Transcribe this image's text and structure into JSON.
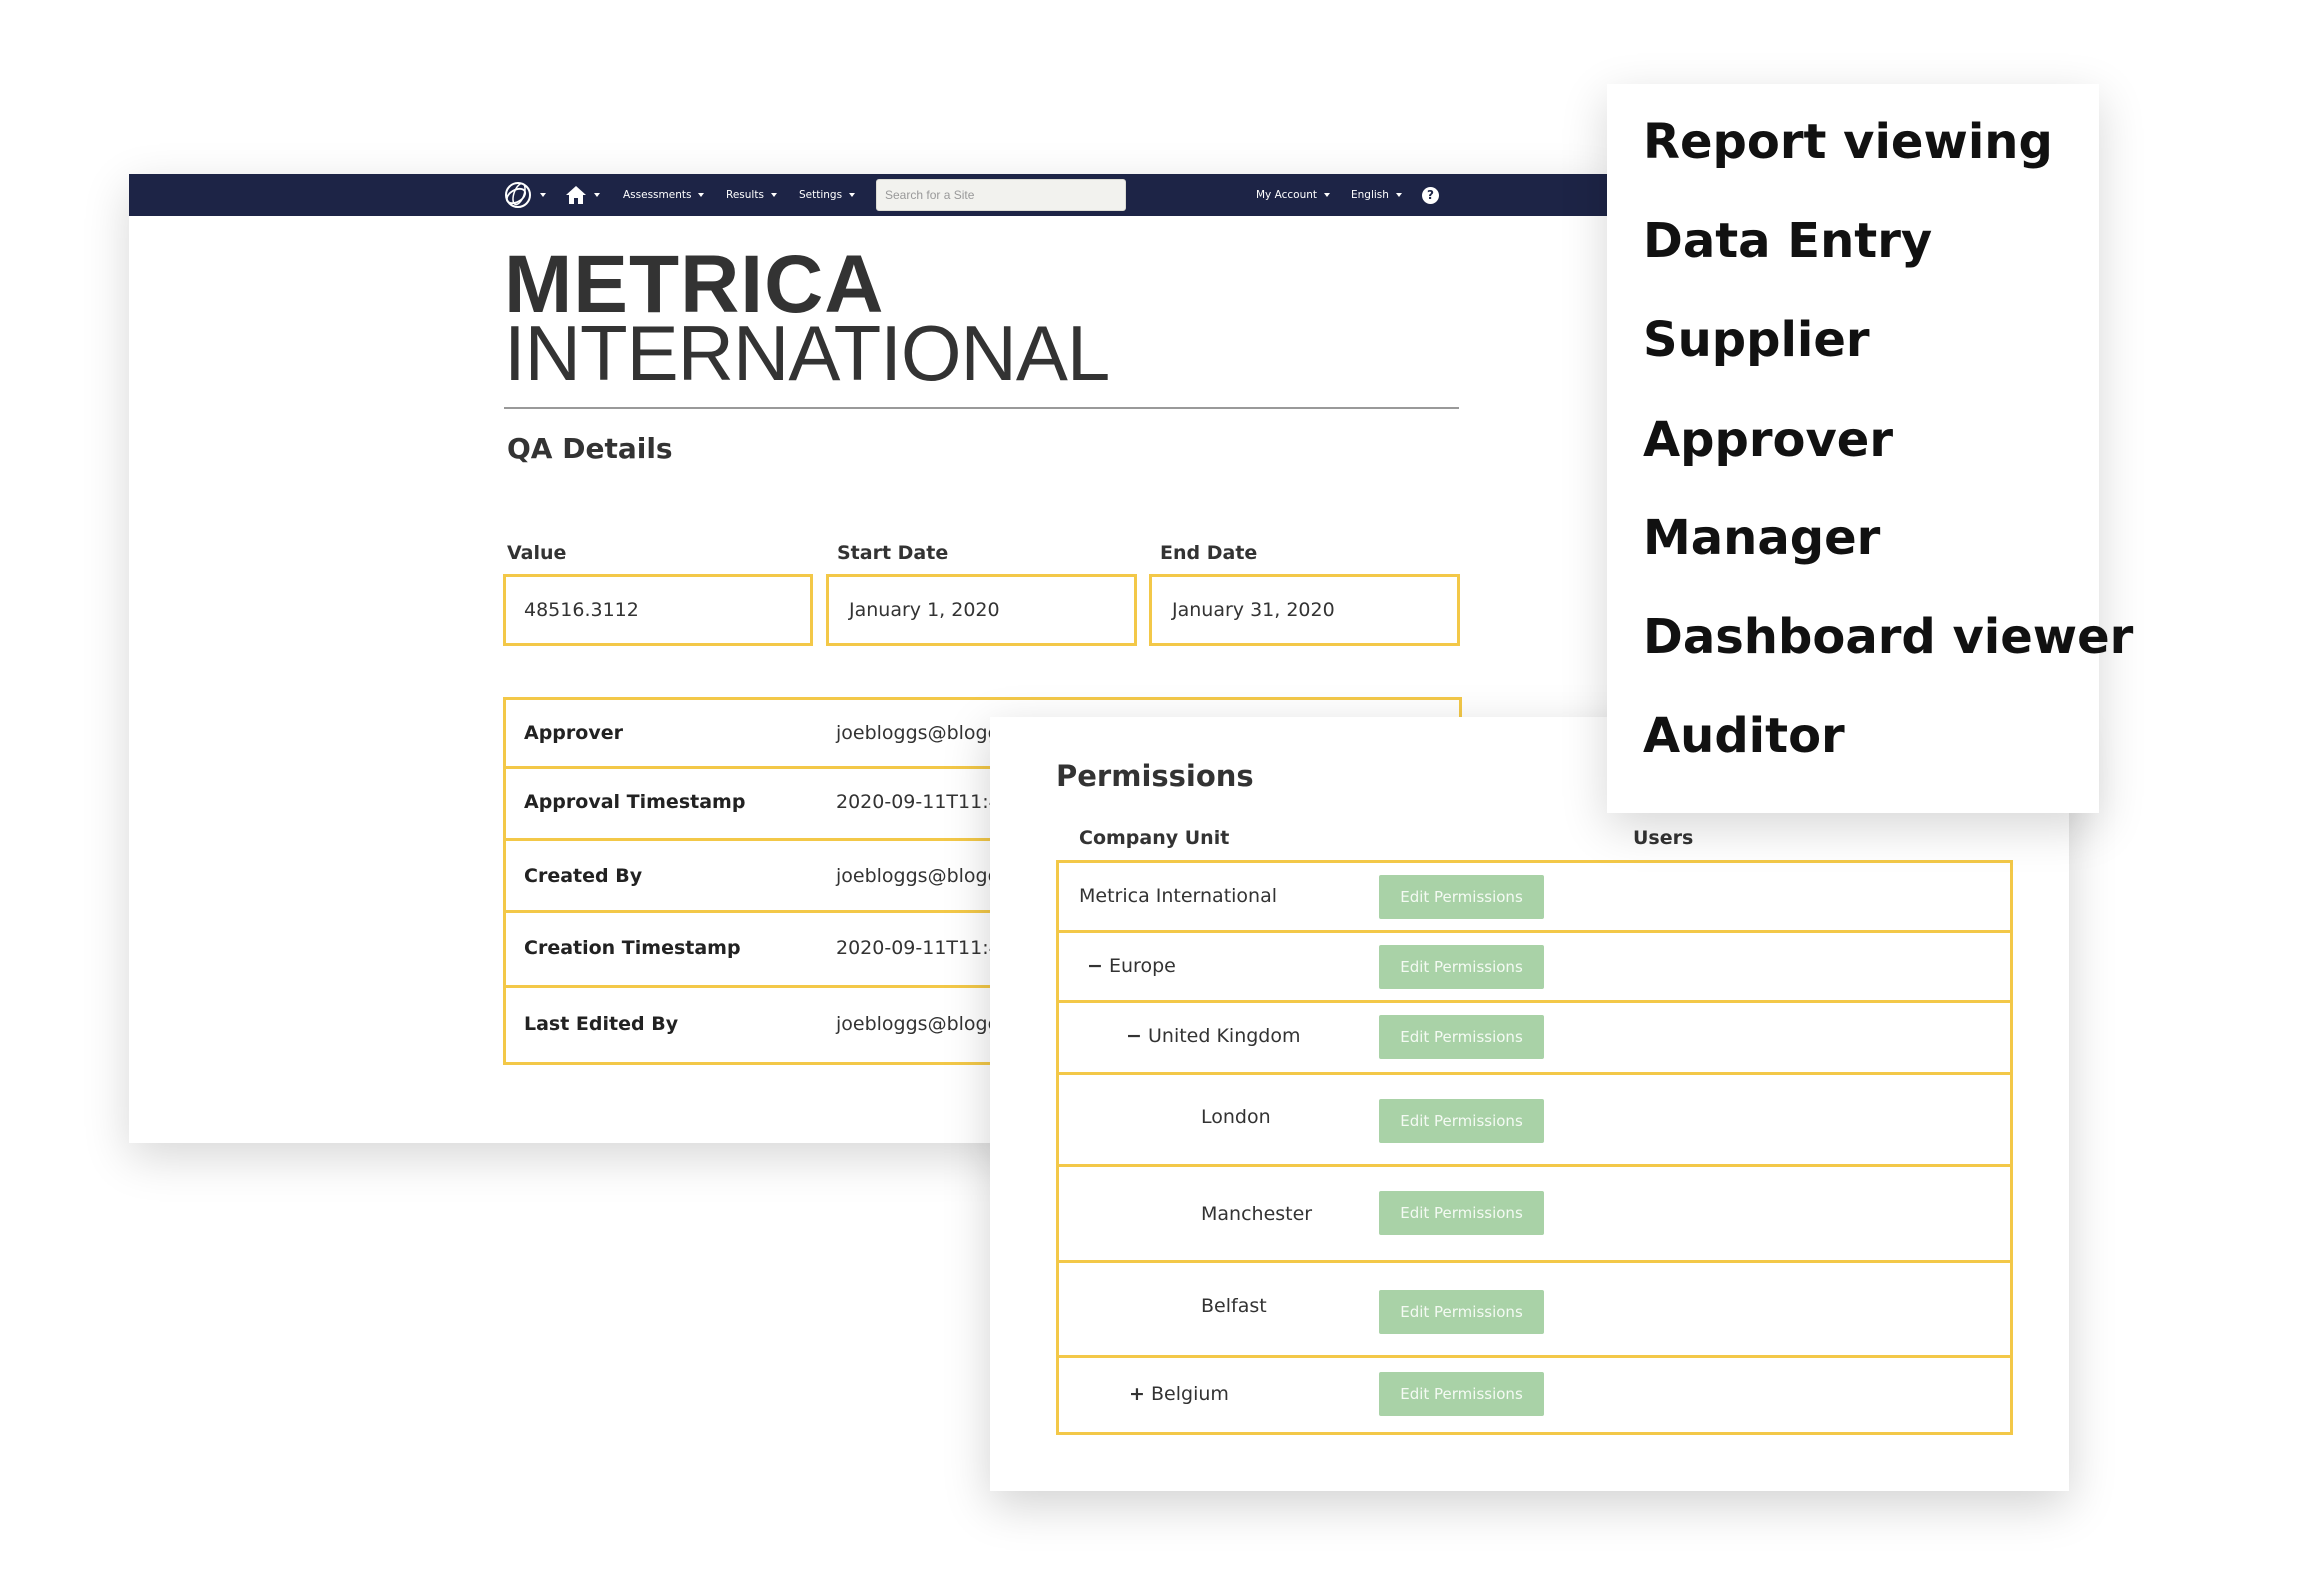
{
  "navbar": {
    "items": [
      "Assessments",
      "Results",
      "Settings"
    ],
    "search_placeholder": "Search for a Site",
    "account": "My Account",
    "language": "English",
    "help": "?"
  },
  "brand": {
    "line1": "METRICA",
    "line2": "INTERNATIONAL"
  },
  "qa": {
    "title": "QA Details",
    "fields": [
      {
        "label": "Value",
        "value": "48516.3112"
      },
      {
        "label": "Start Date",
        "value": "January 1, 2020"
      },
      {
        "label": "End Date",
        "value": "January 31, 2020"
      }
    ],
    "details": [
      {
        "key": "Approver",
        "value": "joebloggs@bloggs"
      },
      {
        "key": "Approval Timestamp",
        "value": "2020-09-11T11:4"
      },
      {
        "key": "Created By",
        "value": "joebloggs@bloggs"
      },
      {
        "key": "Creation Timestamp",
        "value": "2020-09-11T11:4"
      },
      {
        "key": "Last Edited By",
        "value": "joebloggs@bloggs"
      }
    ]
  },
  "permissions": {
    "title": "Permissions",
    "col_unit": "Company Unit",
    "col_users": "Users",
    "button_label": "Edit Permissions",
    "rows": [
      {
        "toggle": "",
        "name": "Metrica International"
      },
      {
        "toggle": "−",
        "name": "Europe"
      },
      {
        "toggle": "−",
        "name": "United Kingdom"
      },
      {
        "toggle": "",
        "name": "London"
      },
      {
        "toggle": "",
        "name": "Manchester"
      },
      {
        "toggle": "",
        "name": "Belfast"
      },
      {
        "toggle": "+",
        "name": "Belgium"
      }
    ]
  },
  "roles": [
    "Report viewing",
    "Data Entry",
    "Supplier",
    "Approver",
    "Manager",
    "Dashboard viewer",
    "Auditor"
  ],
  "colors": {
    "navbar": "#1d2446",
    "highlight_border": "#f3c848",
    "button": "#a9d2a7"
  }
}
